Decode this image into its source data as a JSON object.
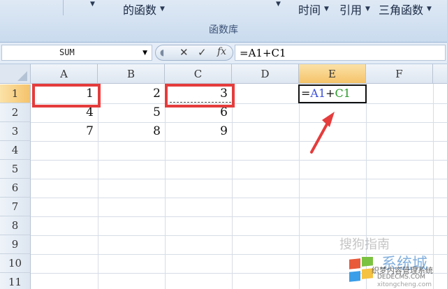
{
  "ribbon": {
    "items": [
      {
        "label": ""
      },
      {
        "label": "的函数"
      },
      {
        "label": ""
      },
      {
        "label": "时间"
      },
      {
        "label": "引用"
      },
      {
        "label": "三角函数"
      }
    ],
    "group_label": "函数库"
  },
  "formula_bar": {
    "name_box": "SUM",
    "cancel_icon": "✕",
    "enter_icon": "✓",
    "fx_label": "fx",
    "formula": "=A1+C1"
  },
  "sheet": {
    "columns": [
      "A",
      "B",
      "C",
      "D",
      "E",
      "F"
    ],
    "selected_column": "E",
    "rows": [
      "1",
      "2",
      "3",
      "4",
      "5",
      "6",
      "7",
      "8",
      "9",
      "10",
      "11"
    ],
    "selected_row": "1",
    "cells": [
      [
        "1",
        "2",
        "3"
      ],
      [
        "4",
        "5",
        "6"
      ],
      [
        "7",
        "8",
        "9"
      ]
    ],
    "edit_cell": {
      "prefix": "=",
      "ref1": "A1",
      "op": "+",
      "ref2": "C1"
    },
    "ref_colors": {
      "ref1": "#3b4fd8",
      "ref2": "#2a9a2a"
    },
    "highlight_color": "#e53c3c"
  },
  "watermarks": {
    "wm1": "搜狗指南",
    "wm2": "系统城",
    "wm3": "织梦内容管理系统",
    "wm4": "DEDECMS.COM",
    "wm5": "xitongcheng.com"
  }
}
